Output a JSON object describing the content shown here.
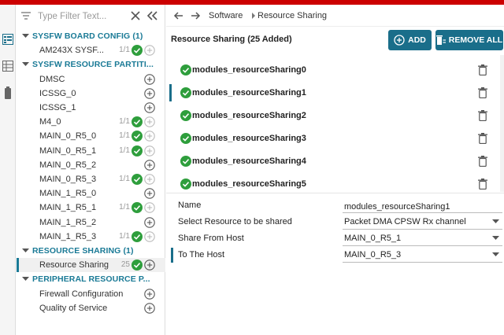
{
  "colors": {
    "accent": "#1a6e8a",
    "category": "#1a7a96",
    "ok": "#2e9e3c",
    "topbar": "#cc0000"
  },
  "filter": {
    "placeholder": "Type Filter Text..."
  },
  "tree": {
    "categories": {
      "board_config": "SYSFW BOARD CONFIG (1)",
      "resource_partition": "SYSFW RESOURCE PARTITI...",
      "resource_sharing": "RESOURCE SHARING (1)",
      "peripheral": "PERIPHERAL RESOURCE P..."
    },
    "board_items": [
      {
        "label": "AM243X SYSF...",
        "count": "1/1"
      }
    ],
    "partition_items": [
      {
        "label": "DMSC",
        "count": ""
      },
      {
        "label": "ICSSG_0",
        "count": ""
      },
      {
        "label": "ICSSG_1",
        "count": ""
      },
      {
        "label": "M4_0",
        "count": "1/1"
      },
      {
        "label": "MAIN_0_R5_0",
        "count": "1/1"
      },
      {
        "label": "MAIN_0_R5_1",
        "count": "1/1"
      },
      {
        "label": "MAIN_0_R5_2",
        "count": ""
      },
      {
        "label": "MAIN_0_R5_3",
        "count": "1/1"
      },
      {
        "label": "MAIN_1_R5_0",
        "count": ""
      },
      {
        "label": "MAIN_1_R5_1",
        "count": "1/1"
      },
      {
        "label": "MAIN_1_R5_2",
        "count": ""
      },
      {
        "label": "MAIN_1_R5_3",
        "count": "1/1"
      }
    ],
    "sharing_items": [
      {
        "label": "Resource Sharing",
        "count": "25"
      }
    ],
    "peripheral_items": [
      {
        "label": "Firewall Configuration"
      },
      {
        "label": "Quality of Service"
      }
    ]
  },
  "breadcrumb": {
    "root": "Software",
    "current": "Resource Sharing"
  },
  "panel": {
    "title": "Resource Sharing (25 Added)",
    "add_label": "ADD",
    "remove_all_label": "REMOVE ALL",
    "instances": [
      "modules_resourceSharing0",
      "modules_resourceSharing1",
      "modules_resourceSharing2",
      "modules_resourceSharing3",
      "modules_resourceSharing4",
      "modules_resourceSharing5"
    ],
    "selected_index": 1
  },
  "form": {
    "name_label": "Name",
    "name_value": "modules_resourceSharing1",
    "resource_label": "Select Resource to be shared",
    "resource_value": "Packet DMA CPSW Rx channel",
    "share_from_label": "Share From Host",
    "share_from_value": "MAIN_0_R5_1",
    "to_host_label": "To The Host",
    "to_host_value": "MAIN_0_R5_3"
  }
}
